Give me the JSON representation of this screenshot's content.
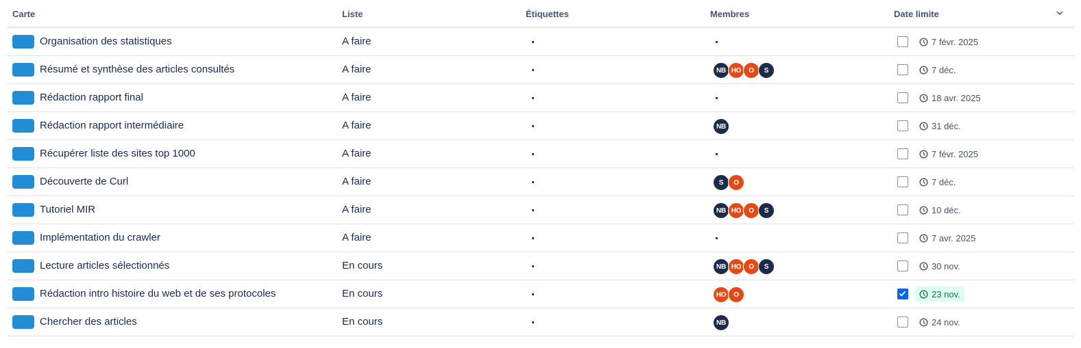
{
  "header": {
    "col_card": "Carte",
    "col_list": "Liste",
    "col_labels": "Étiquettes",
    "col_members": "Membres",
    "col_due": "Date limite"
  },
  "rows": [
    {
      "title": "Organisation des statistiques",
      "list": "A faire",
      "members": [],
      "done": false,
      "due": "7 févr. 2025"
    },
    {
      "title": "Résumé et synthèse des articles consultés",
      "list": "A faire",
      "members": [
        "NB",
        "HO",
        "O",
        "S"
      ],
      "done": false,
      "due": "7 déc."
    },
    {
      "title": "Rédaction rapport final",
      "list": "A faire",
      "members": [],
      "done": false,
      "due": "18 avr. 2025"
    },
    {
      "title": "Rédaction rapport intermédiaire",
      "list": "A faire",
      "members": [
        "NB"
      ],
      "done": false,
      "due": "31 déc."
    },
    {
      "title": "Récupérer liste des sites top 1000",
      "list": "A faire",
      "members": [],
      "done": false,
      "due": "7 févr. 2025"
    },
    {
      "title": "Découverte de Curl",
      "list": "A faire",
      "members": [
        "S",
        "O"
      ],
      "done": false,
      "due": "7 déc."
    },
    {
      "title": "Tutoriel MIR",
      "list": "A faire",
      "members": [
        "NB",
        "HO",
        "O",
        "S"
      ],
      "done": false,
      "due": "10 déc."
    },
    {
      "title": "Implémentation du crawler",
      "list": "A faire",
      "members": [],
      "done": false,
      "due": "7 avr. 2025"
    },
    {
      "title": "Lecture articles sélectionnés",
      "list": "En cours",
      "members": [
        "NB",
        "HO",
        "O",
        "S"
      ],
      "done": false,
      "due": "30 nov."
    },
    {
      "title": "Rédaction intro histoire du web et de ses protocoles",
      "list": "En cours",
      "members": [
        "HO",
        "O"
      ],
      "done": true,
      "due": "23 nov."
    },
    {
      "title": "Chercher des articles",
      "list": "En cours",
      "members": [
        "NB"
      ],
      "done": false,
      "due": "24 nov."
    }
  ],
  "avatar_colors": {
    "NB": "#1c2b4a",
    "S": "#1c2b4a",
    "HO": "#e34a14",
    "O": "#e34a14"
  },
  "cover_color": "#228cd5",
  "icons": {
    "due": "clock-icon",
    "sort": "chevron-down-icon"
  }
}
